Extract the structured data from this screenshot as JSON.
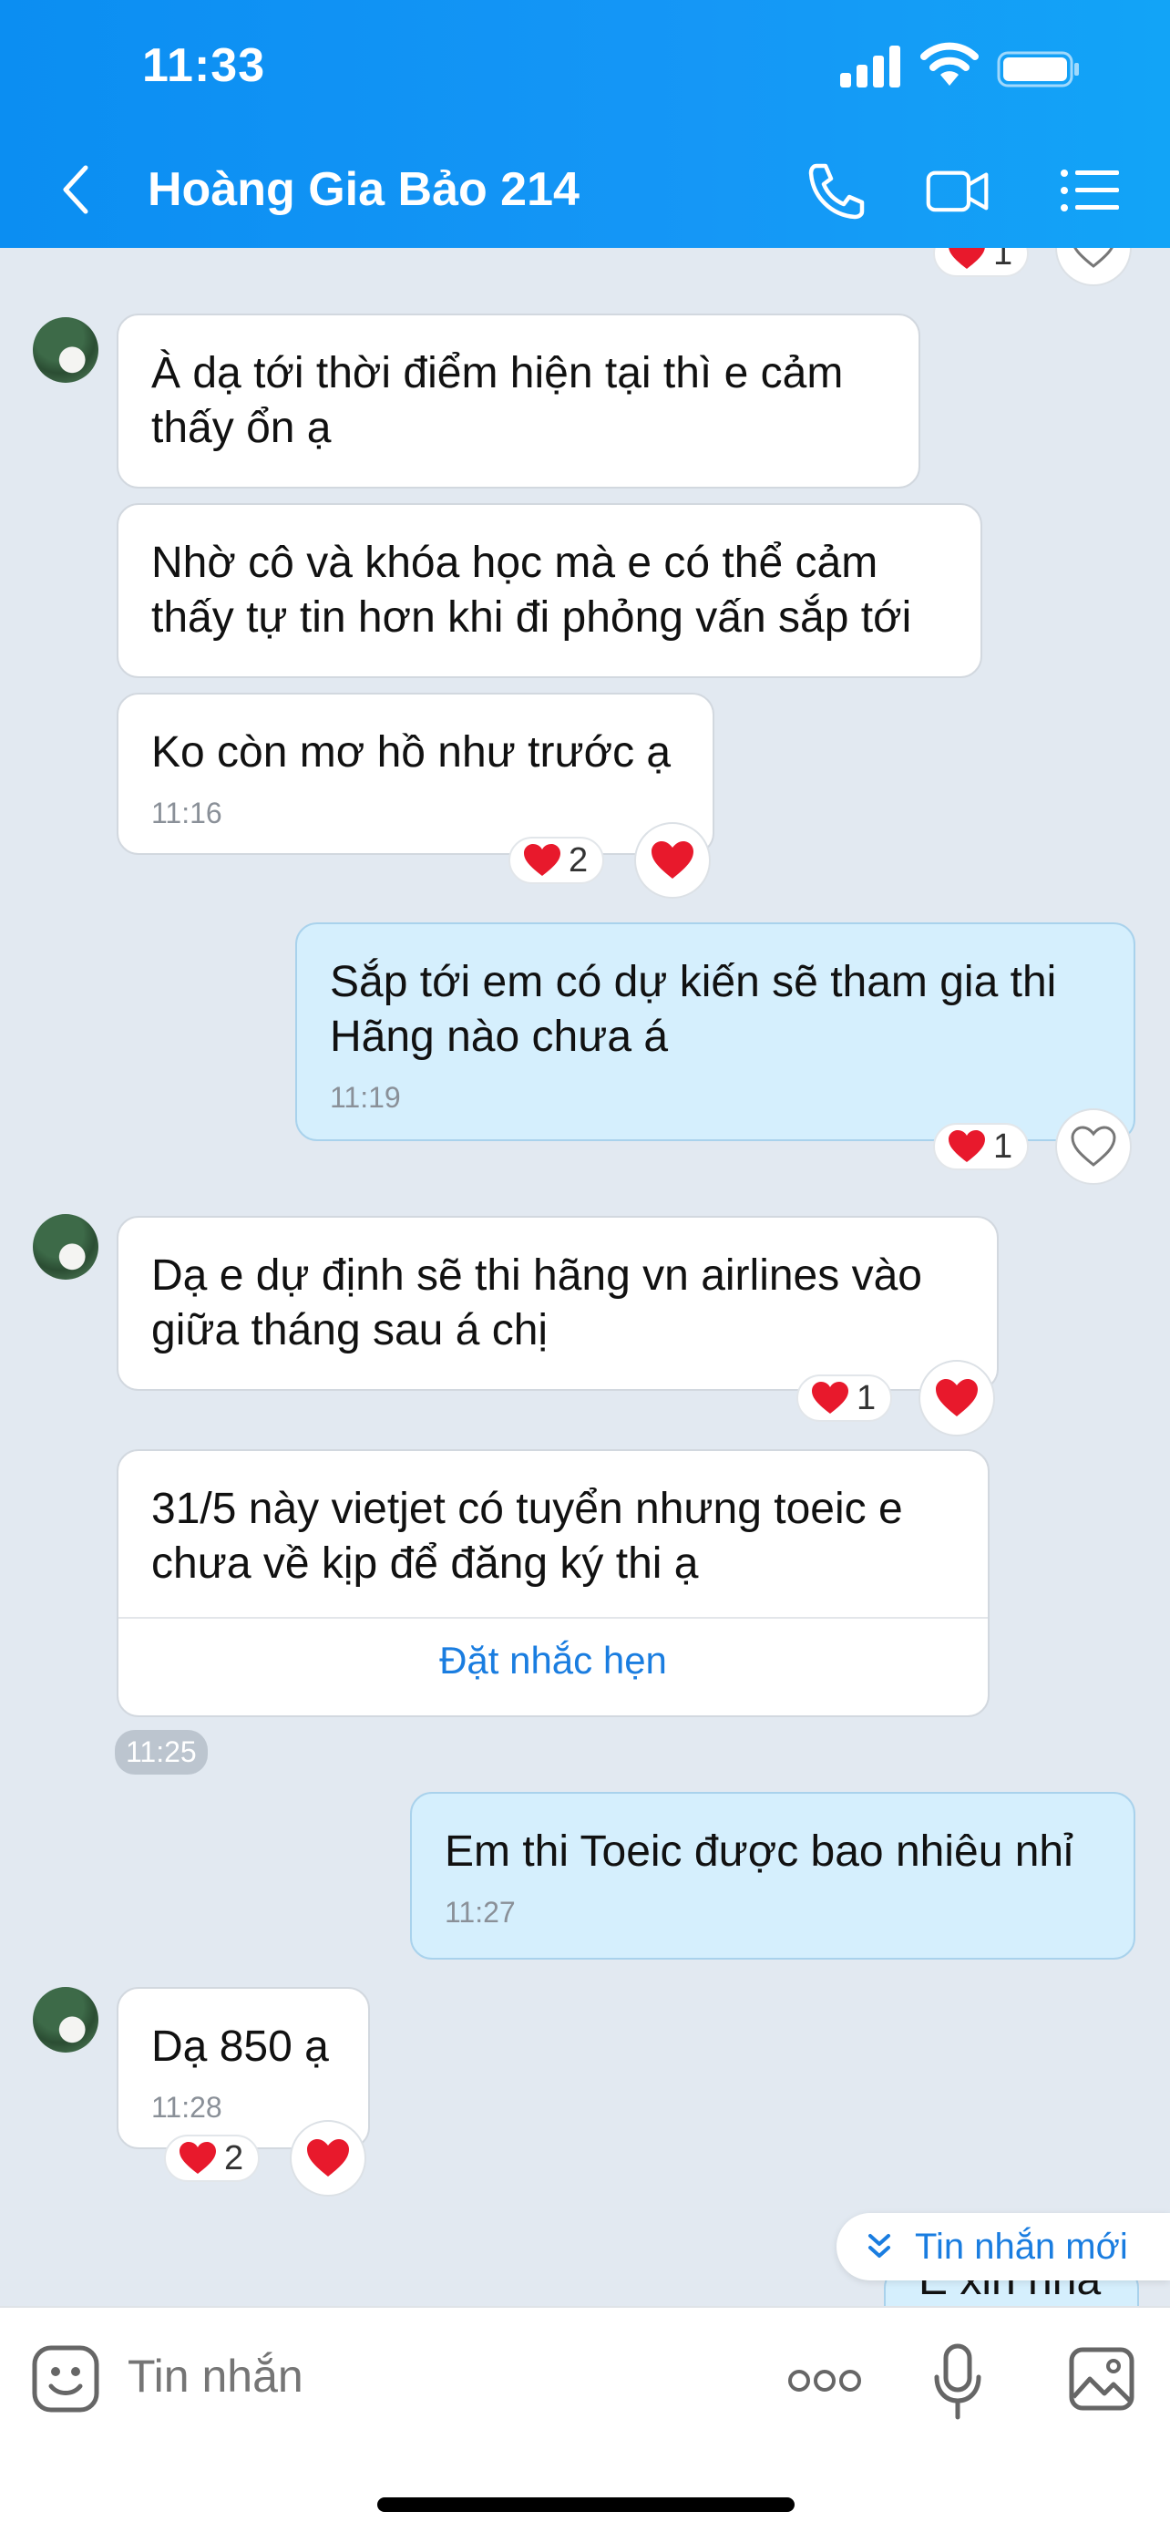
{
  "status": {
    "time": "11:33"
  },
  "header": {
    "title": "Hoàng Gia Bảo 214"
  },
  "messages": {
    "m1": {
      "text": "À dạ tới thời điểm hiện tại thì e cảm\nthấy ổn ạ"
    },
    "m2": {
      "text": "Nhờ cô và khóa học mà e có thể cảm\nthấy tự tin hơn khi đi phỏng vấn sắp tới"
    },
    "m3": {
      "text": "Ko còn mơ hồ như trước ạ",
      "time": "11:16",
      "reaction_count": "2"
    },
    "m4": {
      "text": "Sắp tới em có dự kiến sẽ tham gia thi\nHãng nào chưa á",
      "time": "11:19",
      "reaction_count": "1"
    },
    "m5": {
      "text": "Dạ e dự định sẽ thi hãng vn airlines vào\ngiữa tháng sau á chị",
      "reaction_count": "1"
    },
    "m6": {
      "text": "31/5 này vietjet có tuyển nhưng toeic e\nchưa về kịp để đăng ký thi ạ",
      "reminder_label": "Đặt nhắc hẹn",
      "time": "11:25"
    },
    "m7": {
      "text": "Em thi Toeic được bao nhiêu nhỉ",
      "time": "11:27"
    },
    "m8": {
      "text": "Dạ 850 ạ",
      "time": "11:28",
      "reaction_count": "2"
    },
    "top_reaction_count": "1",
    "partial_text": "E xin nha"
  },
  "new_message_label": "Tin nhắn mới",
  "composer": {
    "placeholder": "Tin nhắn"
  },
  "colors": {
    "header": "#1597f6",
    "sent_bubble": "#d5effd",
    "heart": "#e8192c",
    "link": "#1a7de0"
  }
}
